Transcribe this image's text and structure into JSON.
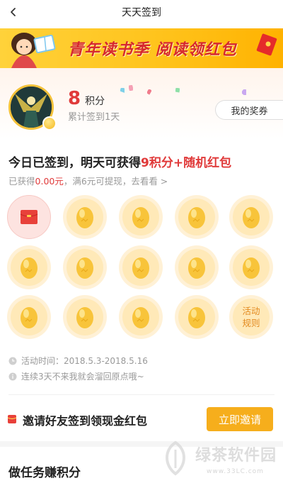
{
  "nav": {
    "title": "天天签到"
  },
  "banner": {
    "text": "青年读书季 阅读领红包"
  },
  "header": {
    "points": "8",
    "points_unit": "积分",
    "cumulative": "累计签到1天",
    "rewards_button": "我的奖券"
  },
  "today": {
    "prefix": "今日已签到，明天可获得",
    "highlight": "9积分+随机红包",
    "earned_prefix": "已获得",
    "earned_amount": "0.00元",
    "earned_suffix": "，满6元可提现，去看看 >"
  },
  "grid": {
    "rules_label_line1": "活动",
    "rules_label_line2": "规则"
  },
  "info": {
    "time": "活动时间：2018.5.3-2018.5.16",
    "notice": "连续3天不来我就会溜回原点哦~"
  },
  "invite": {
    "text": "邀请好友签到领现金红包",
    "button": "立即邀请"
  },
  "tasks": {
    "title": "做任务赚积分"
  },
  "watermark": {
    "text": "绿茶软件园",
    "url": "www.33LC.com"
  },
  "colors": {
    "accent_red": "#e03a3a",
    "accent_orange": "#f6ae1c",
    "banner_yellow": "#ffc21a"
  },
  "icons": [
    "back-chevron-icon",
    "red-envelope-icon",
    "egg-icon",
    "clock-icon",
    "info-icon",
    "coin-icon"
  ]
}
